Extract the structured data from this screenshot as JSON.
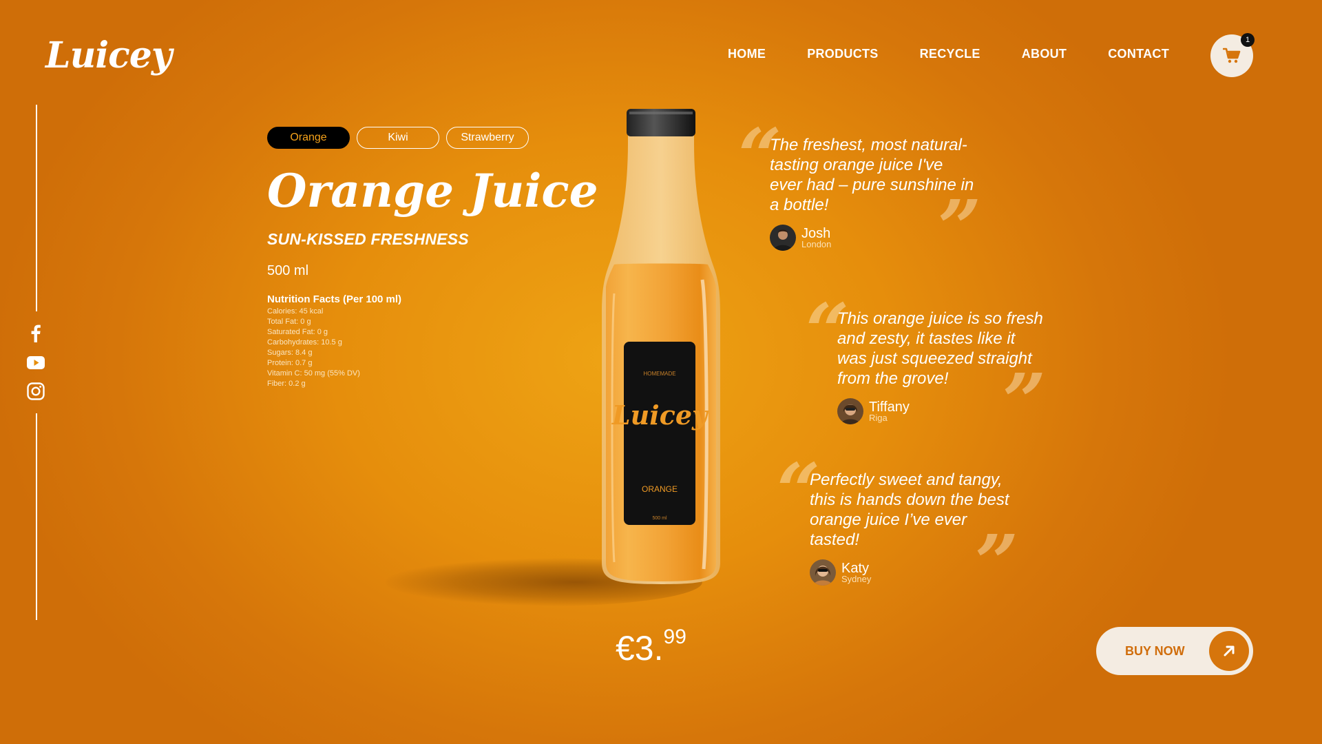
{
  "brand": {
    "logo": "Luicey"
  },
  "nav": [
    "HOME",
    "PRODUCTS",
    "RECYCLE",
    "ABOUT",
    "CONTACT"
  ],
  "cart": {
    "count": "1"
  },
  "social": [
    "facebook-icon",
    "youtube-icon",
    "instagram-icon"
  ],
  "flavors": [
    {
      "label": "Orange",
      "active": true
    },
    {
      "label": "Kiwi",
      "active": false
    },
    {
      "label": "Strawberry",
      "active": false
    }
  ],
  "product": {
    "title": "Orange Juice",
    "subtitle": "SUN-KISSED FRESHNESS",
    "volume": "500 ml",
    "nutrition_title": "Nutrition Facts (Per 100 ml)",
    "nutrition": [
      "Calories: 45 kcal",
      "Total Fat: 0 g",
      "Saturated Fat: 0 g",
      "Carbohydrates: 10.5 g",
      "Sugars: 8.4 g",
      "Protein: 0.7 g",
      "Vitamin C: 50 mg (55% DV)",
      "Fiber: 0.2 g"
    ],
    "label": {
      "top": "HOMEMADE",
      "brand": "Luicey",
      "flavor": "ORANGE",
      "volume": "500 ml"
    }
  },
  "reviews": [
    {
      "text": "The freshest, most natural-tasting orange juice I've ever had – pure sunshine in a bottle!",
      "name": "Josh",
      "city": "London"
    },
    {
      "text": "This orange juice is so fresh and zesty, it tastes like it was just squeezed straight from the grove!",
      "name": "Tiffany",
      "city": "Riga"
    },
    {
      "text": "Perfectly sweet and tangy, this is hands down the best orange juice I’ve ever tasted!",
      "name": "Katy",
      "city": "Sydney"
    }
  ],
  "price": {
    "main": "€3.",
    "cents": "99"
  },
  "buy": {
    "label": "BUY NOW"
  },
  "colors": {
    "accent": "#e68e0c",
    "dark": "#000000",
    "cream": "#f4ece2",
    "button_text": "#d06d0b"
  }
}
